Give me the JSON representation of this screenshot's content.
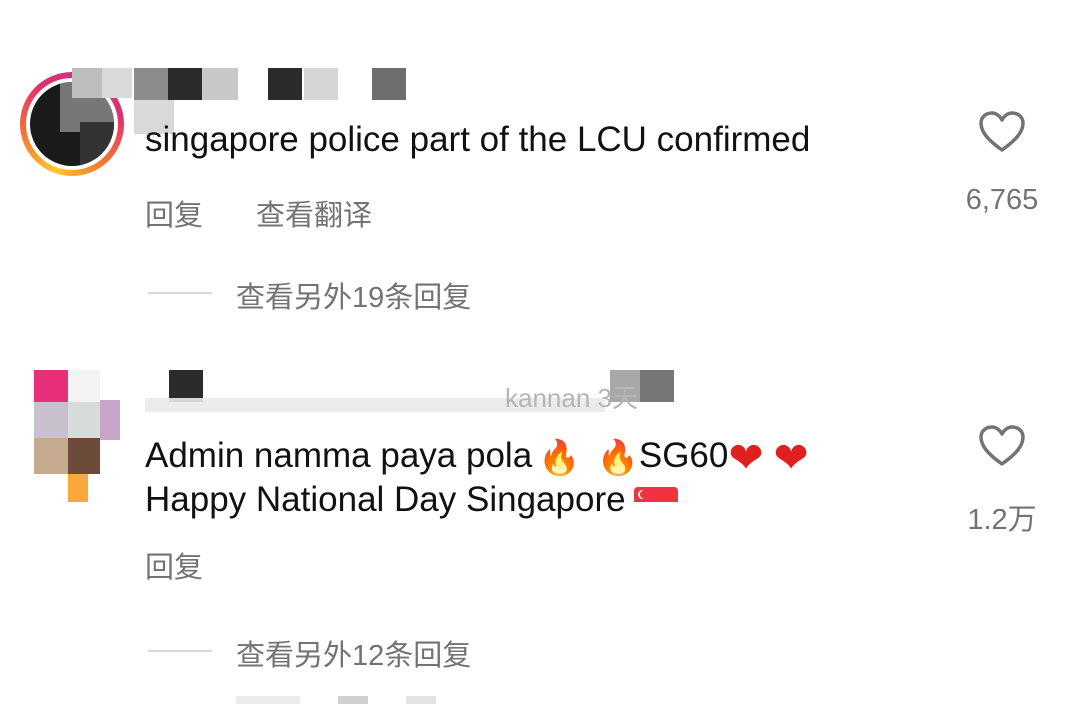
{
  "comments": [
    {
      "text": "singapore police part of the LCU confirmed",
      "actions": {
        "reply": "回复",
        "translate": "查看翻译"
      },
      "likes": "6,765",
      "view_replies": "查看另外19条回复"
    },
    {
      "text_line1": "Admin namma paya pola",
      "text_mid": "SG60",
      "text_line2": "Happy National Day Singapore",
      "emojis": {
        "fire": "🔥",
        "heart": "❤"
      },
      "username_fragment": "kannan 3天",
      "actions": {
        "reply": "回复"
      },
      "likes": "1.2万",
      "view_replies": "查看另外12条回复"
    }
  ],
  "icons": {
    "like": "heart-outline-icon",
    "flag": "singapore-flag"
  },
  "colors": {
    "secondary_text": "#737373",
    "flag_red": "#ef3340",
    "heart_red": "#e0201f"
  }
}
